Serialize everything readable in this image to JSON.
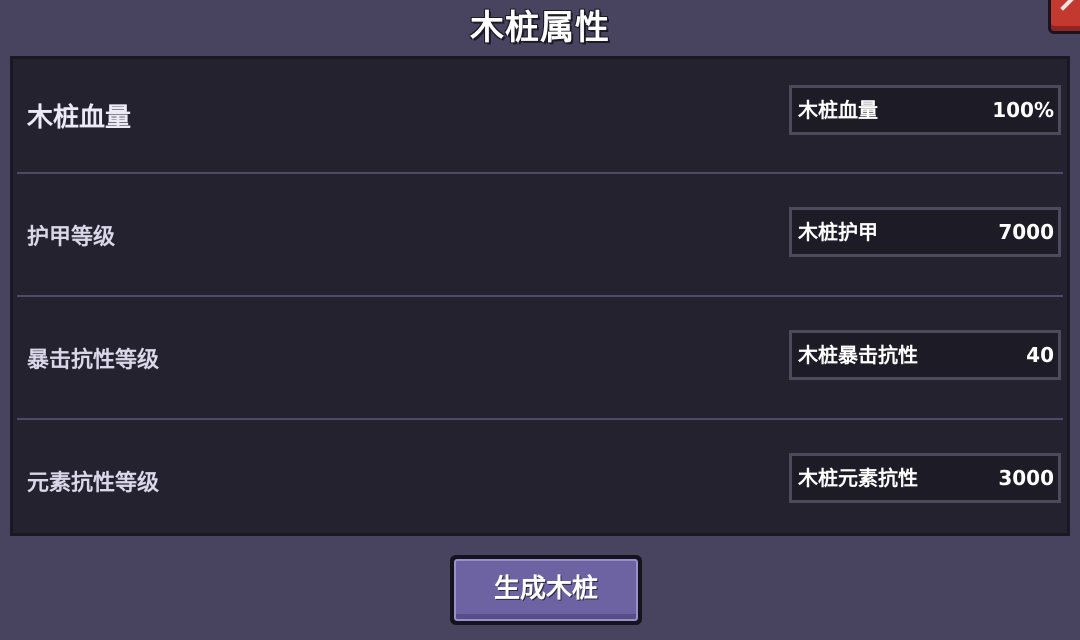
{
  "dialog": {
    "title": "木桩属性"
  },
  "rows": [
    {
      "label": "木桩血量",
      "field_name": "木桩血量",
      "field_value": "100%"
    },
    {
      "label": "护甲等级",
      "field_name": "木桩护甲",
      "field_value": "7000"
    },
    {
      "label": "暴击抗性等级",
      "field_name": "木桩暴击抗性",
      "field_value": "40"
    },
    {
      "label": "元素抗性等级",
      "field_name": "木桩元素抗性",
      "field_value": "3000"
    }
  ],
  "footer": {
    "generate_label": "生成木桩"
  },
  "colors": {
    "window_bg": "#48435f",
    "panel_bg": "#24222f",
    "button_bg": "#6d63a3",
    "close_bg": "#c4392f"
  },
  "icons": {
    "close": "close-icon"
  }
}
